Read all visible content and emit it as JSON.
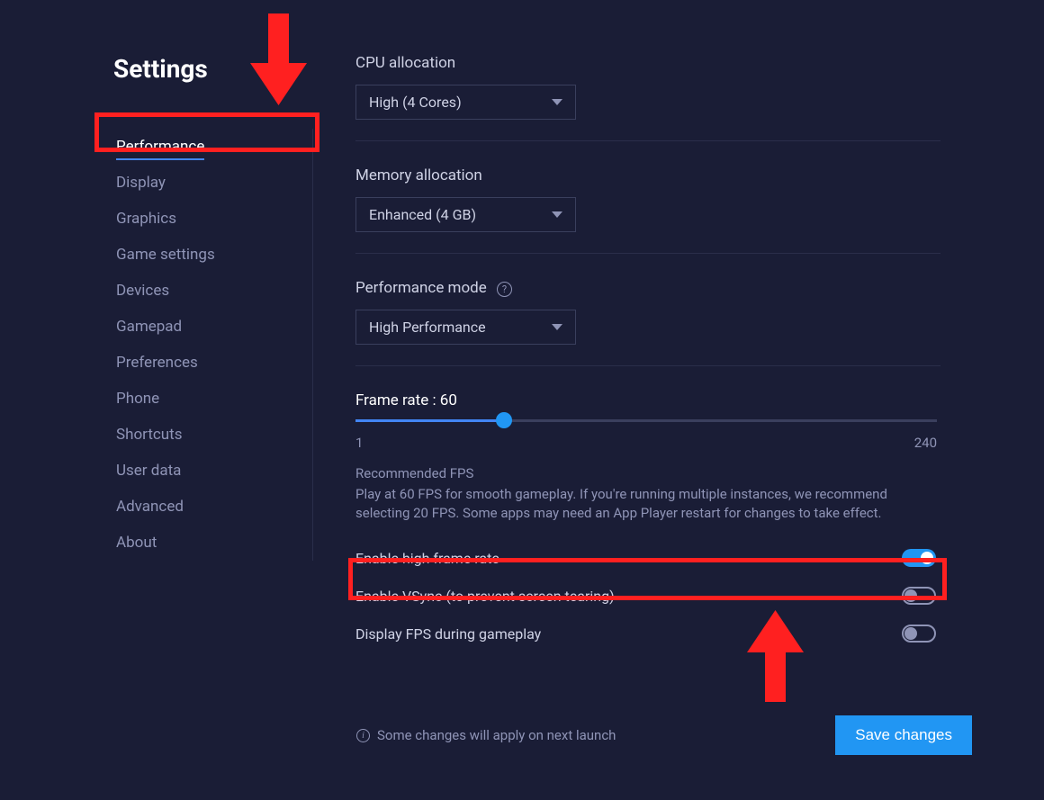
{
  "page_title": "Settings",
  "sidebar": {
    "items": [
      {
        "label": "Performance",
        "active": true
      },
      {
        "label": "Display",
        "active": false
      },
      {
        "label": "Graphics",
        "active": false
      },
      {
        "label": "Game settings",
        "active": false
      },
      {
        "label": "Devices",
        "active": false
      },
      {
        "label": "Gamepad",
        "active": false
      },
      {
        "label": "Preferences",
        "active": false
      },
      {
        "label": "Phone",
        "active": false
      },
      {
        "label": "Shortcuts",
        "active": false
      },
      {
        "label": "User data",
        "active": false
      },
      {
        "label": "Advanced",
        "active": false
      },
      {
        "label": "About",
        "active": false
      }
    ]
  },
  "cpu": {
    "label": "CPU allocation",
    "value": "High (4 Cores)"
  },
  "memory": {
    "label": "Memory allocation",
    "value": "Enhanced (4 GB)"
  },
  "performance_mode": {
    "label": "Performance mode",
    "value": "High Performance"
  },
  "frame_rate": {
    "label": "Frame rate : 60",
    "min": "1",
    "max": "240",
    "value": 60,
    "recommended_title": "Recommended FPS",
    "recommended_text": "Play at 60 FPS for smooth gameplay. If you're running multiple instances, we recommend selecting 20 FPS. Some apps may need an App Player restart for changes to take effect."
  },
  "toggles": {
    "high_fps": {
      "label": "Enable high frame rate",
      "on": true
    },
    "vsync": {
      "label": "Enable VSync (to prevent screen tearing)",
      "on": false
    },
    "display_fps": {
      "label": "Display FPS during gameplay",
      "on": false
    }
  },
  "footer": {
    "note": "Some changes will apply on next launch",
    "save_button": "Save changes"
  }
}
